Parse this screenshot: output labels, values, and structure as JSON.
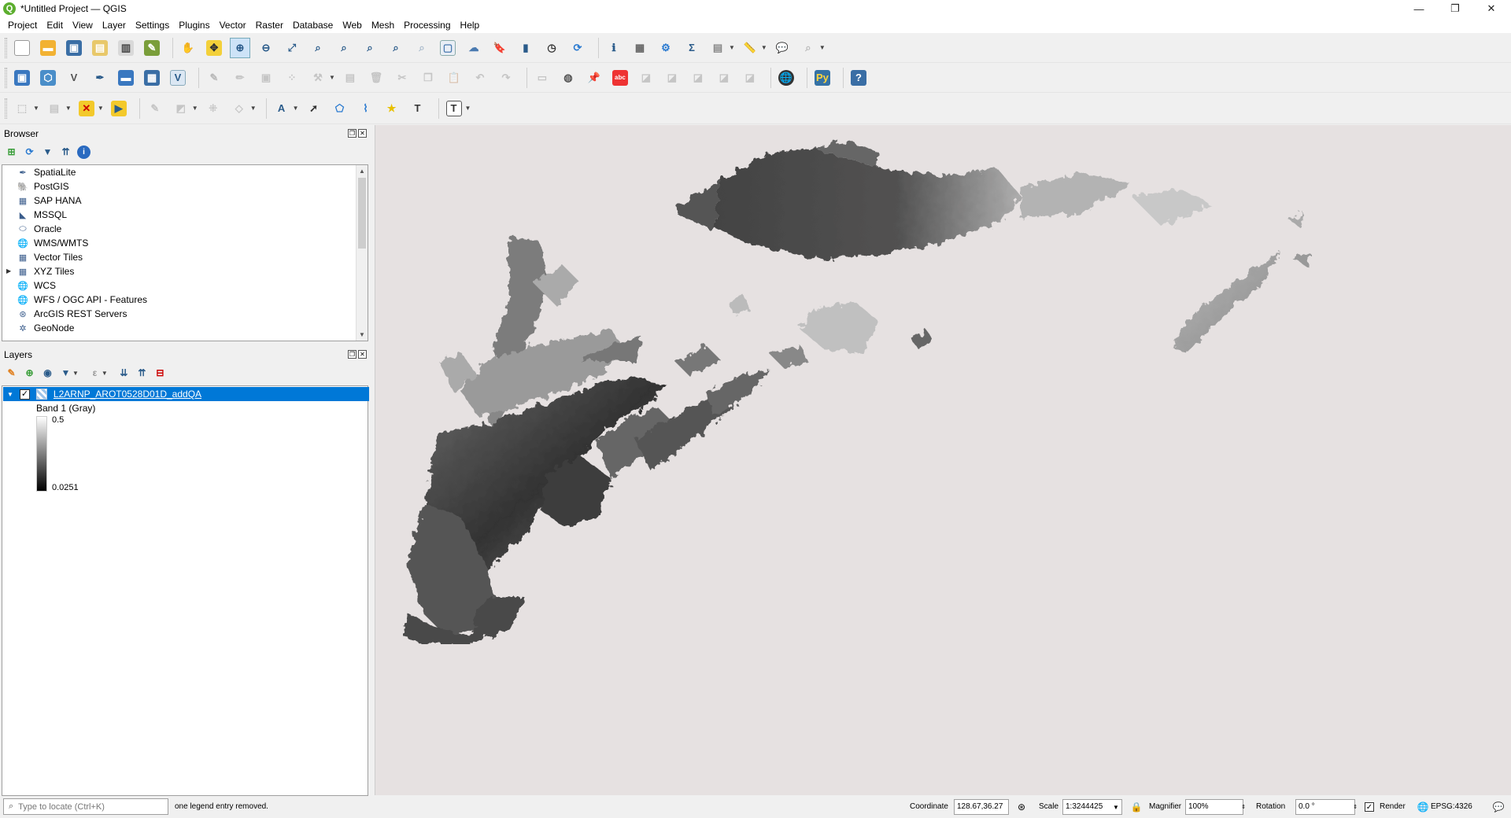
{
  "window": {
    "title": "*Untitled Project — QGIS",
    "logo": "Q",
    "controls": [
      "—",
      "❐",
      "✕"
    ]
  },
  "menu": [
    "Project",
    "Edit",
    "View",
    "Layer",
    "Settings",
    "Plugins",
    "Vector",
    "Raster",
    "Database",
    "Web",
    "Mesh",
    "Processing",
    "Help"
  ],
  "browser": {
    "title": "Browser",
    "items": [
      {
        "label": "SpatiaLite",
        "icon": "feather-icon",
        "glyph": "✒"
      },
      {
        "label": "PostGIS",
        "icon": "elephant-icon",
        "glyph": "🐘"
      },
      {
        "label": "SAP HANA",
        "icon": "grid-icon",
        "glyph": "▦"
      },
      {
        "label": "MSSQL",
        "icon": "mssql-icon",
        "glyph": "◣"
      },
      {
        "label": "Oracle",
        "icon": "oracle-icon",
        "glyph": "⬭"
      },
      {
        "label": "WMS/WMTS",
        "icon": "globe-icon",
        "glyph": "🌐"
      },
      {
        "label": "Vector Tiles",
        "icon": "tiles-icon",
        "glyph": "▦"
      },
      {
        "label": "XYZ Tiles",
        "icon": "tiles-icon",
        "glyph": "▦",
        "expandable": true
      },
      {
        "label": "WCS",
        "icon": "globe-icon",
        "glyph": "🌐"
      },
      {
        "label": "WFS / OGC API - Features",
        "icon": "globe-icon",
        "glyph": "🌐"
      },
      {
        "label": "ArcGIS REST Servers",
        "icon": "arcgis-icon",
        "glyph": "⊛"
      },
      {
        "label": "GeoNode",
        "icon": "geonode-icon",
        "glyph": "✲"
      }
    ]
  },
  "layers": {
    "title": "Layers",
    "layer_name": "L2ARNP_AROT0528D01D_addQA",
    "band": "Band 1 (Gray)",
    "max": "0.5",
    "min": "0.0251"
  },
  "status": {
    "search_placeholder": "Type to locate (Ctrl+K)",
    "message": "one legend entry removed.",
    "coordinate_label": "Coordinate",
    "coordinate": "128.67,36.27",
    "scale_label": "Scale",
    "scale": "1:3244425",
    "magnifier_label": "Magnifier",
    "magnifier": "100%",
    "rotation_label": "Rotation",
    "rotation": "0.0 °",
    "render_label": "Render",
    "crs": "EPSG:4326"
  }
}
